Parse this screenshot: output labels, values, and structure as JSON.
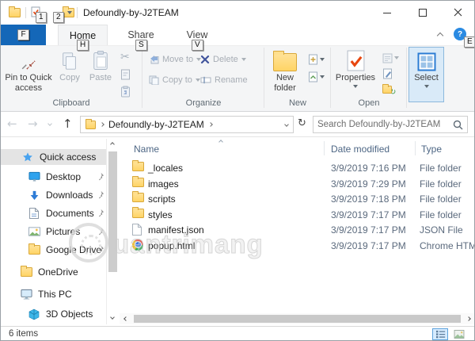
{
  "titlebar": {
    "title": "Defoundly-by-J2TEAM",
    "keytips": {
      "qat_properties": "1",
      "qat_new_folder": "2"
    }
  },
  "tabs": {
    "home": "Home",
    "share": "Share",
    "view": "View",
    "keytips": {
      "file": "F",
      "home": "H",
      "share": "S",
      "view": "V",
      "help": "E"
    }
  },
  "ribbon": {
    "groups": {
      "clipboard": "Clipboard",
      "organize": "Organize",
      "new": "New",
      "open": "Open"
    },
    "buttons": {
      "pin_to_quick_access": "Pin to Quick access",
      "copy": "Copy",
      "paste": "Paste",
      "move_to": "Move to",
      "copy_to": "Copy to",
      "delete": "Delete",
      "rename": "Rename",
      "new_folder": "New folder",
      "properties": "Properties",
      "select": "Select"
    }
  },
  "navbar": {
    "breadcrumb": "Defoundly-by-J2TEAM",
    "search_placeholder": "Search Defoundly-by-J2TEAM"
  },
  "sidebar": {
    "items": [
      {
        "label": "Quick access",
        "pinned": false
      },
      {
        "label": "Desktop",
        "pinned": true
      },
      {
        "label": "Downloads",
        "pinned": true
      },
      {
        "label": "Documents",
        "pinned": true
      },
      {
        "label": "Pictures",
        "pinned": true
      },
      {
        "label": "Google Drive",
        "pinned": true
      },
      {
        "label": "OneDrive",
        "pinned": false
      },
      {
        "label": "This PC",
        "pinned": false
      },
      {
        "label": "3D Objects",
        "pinned": false
      }
    ]
  },
  "files": {
    "columns": {
      "name": "Name",
      "date": "Date modified",
      "type": "Type"
    },
    "rows": [
      {
        "name": "_locales",
        "date": "3/9/2019 7:16 PM",
        "type": "File folder",
        "icon": "folder-icon"
      },
      {
        "name": "images",
        "date": "3/9/2019 7:29 PM",
        "type": "File folder",
        "icon": "folder-icon"
      },
      {
        "name": "scripts",
        "date": "3/9/2019 7:18 PM",
        "type": "File folder",
        "icon": "folder-icon"
      },
      {
        "name": "styles",
        "date": "3/9/2019 7:17 PM",
        "type": "File folder",
        "icon": "folder-icon"
      },
      {
        "name": "manifest.json",
        "date": "3/9/2019 7:17 PM",
        "type": "JSON File",
        "icon": "json-file-icon"
      },
      {
        "name": "popup.html",
        "date": "3/9/2019 7:17 PM",
        "type": "Chrome HTM",
        "icon": "chrome-icon"
      }
    ]
  },
  "statusbar": {
    "items_count": "6 items"
  },
  "watermark": {
    "text": "uantrimang"
  },
  "colors": {
    "file_tab_blue": "#1467b8",
    "folder_yellow": "#ffd465",
    "select_hover_bg": "#d9eaf8",
    "accent_blue": "#2b7cd3"
  }
}
